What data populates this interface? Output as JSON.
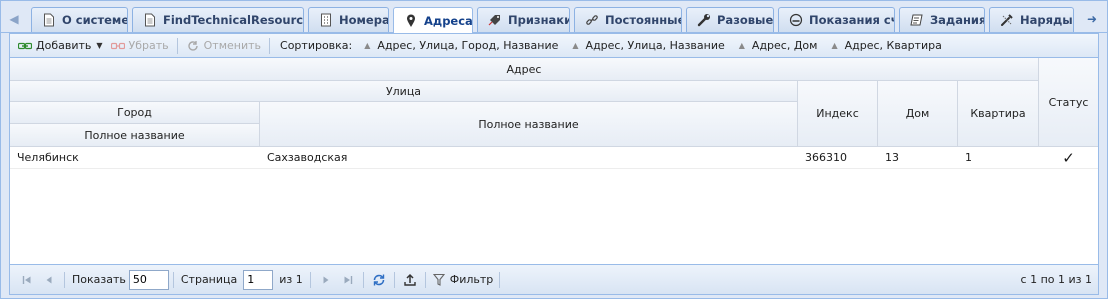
{
  "tabs": [
    {
      "label": "О системе",
      "icon": "document-icon",
      "active": false
    },
    {
      "label": "FindTechnicalResources",
      "icon": "document-icon",
      "active": false
    },
    {
      "label": "Номера",
      "icon": "phone-number-icon",
      "active": false
    },
    {
      "label": "Адреса",
      "icon": "map-pin-icon",
      "active": true
    },
    {
      "label": "Признаки",
      "icon": "tag-pin-icon",
      "active": false
    },
    {
      "label": "Постоянные",
      "icon": "link-icon",
      "active": false
    },
    {
      "label": "Разовые",
      "icon": "wrench-icon",
      "active": false
    },
    {
      "label": "Показания сч.",
      "icon": "meter-icon",
      "active": false
    },
    {
      "label": "Задания",
      "icon": "task-list-icon",
      "active": false
    },
    {
      "label": "Наряды",
      "icon": "tools-icon",
      "active": false
    }
  ],
  "toolbar": {
    "add_label": "Добавить",
    "remove_label": "Убрать",
    "cancel_label": "Отменить",
    "sort_label": "Сортировка:",
    "sort_options": [
      "Адрес, Улица, Город, Название",
      "Адрес, Улица, Название",
      "Адрес, Дом",
      "Адрес, Квартира"
    ]
  },
  "grid": {
    "headers": {
      "address": "Адрес",
      "street": "Улица",
      "city": "Город",
      "city_full_name": "Полное название",
      "street_full_name": "Полное название",
      "index": "Индекс",
      "house": "Дом",
      "apartment": "Квартира",
      "status": "Статус"
    },
    "rows": [
      {
        "city_full_name": "Челябинск",
        "street_full_name": "Сахзаводская",
        "index": "366310",
        "house": "13",
        "apartment": "1",
        "status": "✓"
      }
    ]
  },
  "pager": {
    "show_label": "Показать",
    "page_size": "50",
    "page_label": "Страница",
    "page_value": "1",
    "of_label": "из 1",
    "filter_label": "Фильтр",
    "display_msg": "с 1 по 1 из 1"
  }
}
